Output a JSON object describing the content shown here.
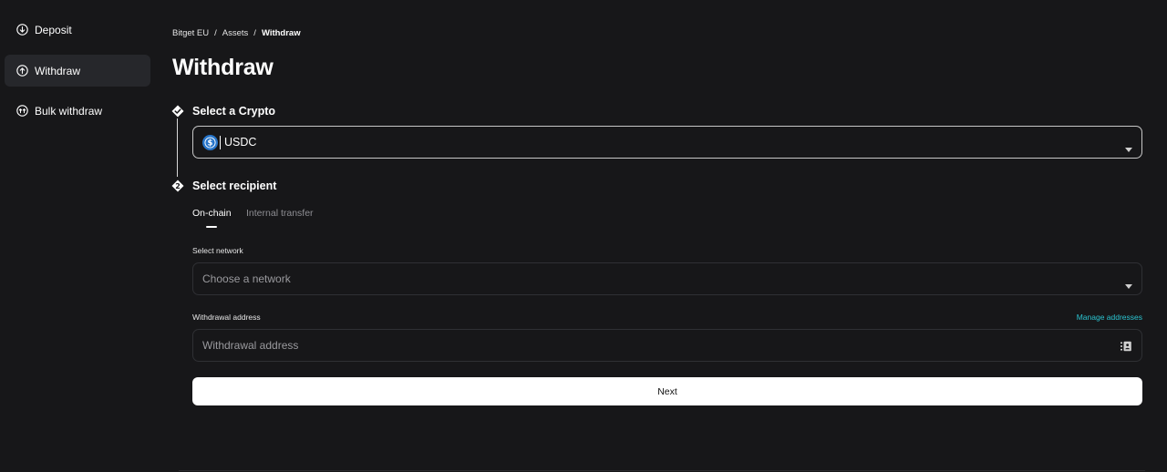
{
  "sidebar": {
    "items": [
      {
        "label": "Deposit",
        "icon": "arrow-down-circle-icon",
        "active": false
      },
      {
        "label": "Withdraw",
        "icon": "arrow-up-circle-icon",
        "active": true
      },
      {
        "label": "Bulk withdraw",
        "icon": "bulk-transfer-icon",
        "active": false
      }
    ]
  },
  "breadcrumb": {
    "items": [
      "Bitget EU",
      "Assets",
      "Withdraw"
    ],
    "separator": "/"
  },
  "page": {
    "title": "Withdraw"
  },
  "steps": {
    "crypto": {
      "title": "Select a Crypto",
      "selected_coin": "USDC",
      "coin_icon": "usdc-coin-icon"
    },
    "recipient": {
      "title": "Select recipient",
      "tabs": [
        {
          "label": "On-chain",
          "active": true
        },
        {
          "label": "Internal transfer",
          "active": false
        }
      ],
      "network": {
        "label": "Select network",
        "placeholder": "Choose a network"
      },
      "address": {
        "label": "Withdrawal address",
        "placeholder": "Withdrawal address",
        "manage_link": "Manage addresses"
      }
    }
  },
  "actions": {
    "next_label": "Next"
  },
  "colors": {
    "background": "#171719",
    "sidebar_active": "#26272b",
    "accent_link": "#2bc4d1",
    "primary_button": "#ffffff",
    "usdc_blue": "#2775ca"
  }
}
